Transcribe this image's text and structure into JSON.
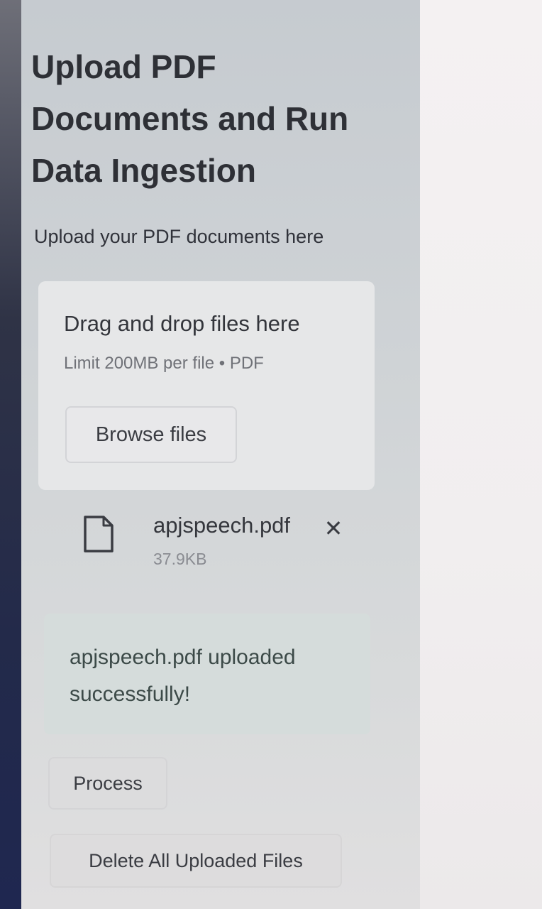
{
  "sidebar": {
    "title": "Upload PDF Documents and Run Data Ingestion",
    "uploader_label": "Upload your PDF documents here",
    "dropzone": {
      "title": "Drag and drop files here",
      "limit": "Limit 200MB per file • PDF",
      "browse_label": "Browse files"
    },
    "uploaded_file": {
      "name": "apjspeech.pdf",
      "size": "37.9KB",
      "icon": "file-icon",
      "remove_icon": "close-icon",
      "remove_glyph": "✕"
    },
    "success_message": "apjspeech.pdf uploaded successfully!",
    "process_label": "Process",
    "delete_label": "Delete All Uploaded Files"
  },
  "colors": {
    "sidebar_bg": "#cdd1d4",
    "main_bg": "#f3eff1",
    "success_bg": "#d5dcdb",
    "text": "#2e3036"
  }
}
